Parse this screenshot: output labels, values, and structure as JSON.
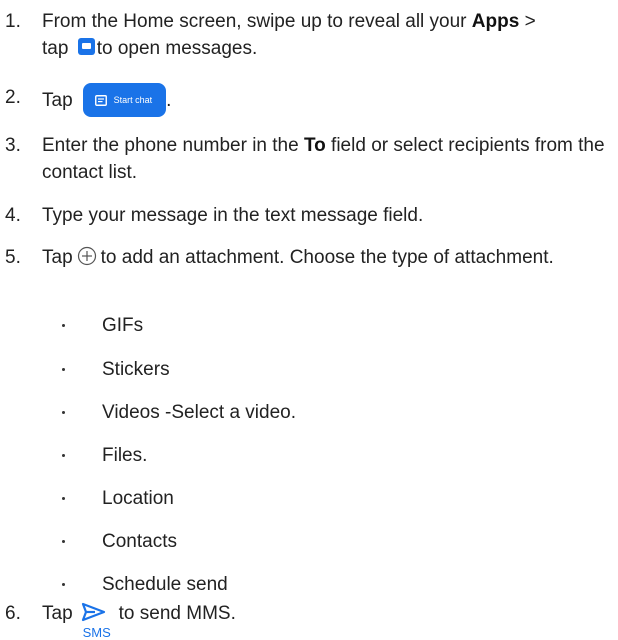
{
  "steps": [
    {
      "num": "1.",
      "pre": "From the Home screen, swipe up to reveal all your ",
      "bold": "Apps",
      "mid": " >",
      "line2_pre": "tap ",
      "icon": "messages-icon",
      "post": "to open messages."
    },
    {
      "num": "2.",
      "pre": "Tap",
      "button_label": "Start chat",
      "post": "."
    },
    {
      "num": "3.",
      "pre": "Enter the phone number in the ",
      "bold": "To",
      "post": " field or select recipients from the contact list."
    },
    {
      "num": "4.",
      "text": "Type your message in the text message field."
    },
    {
      "num": "5.",
      "pre": "Tap",
      "icon": "plus-circle-icon",
      "post": "to add an attachment. Choose the type of attachment."
    },
    {
      "num": "6.",
      "pre": "Tap",
      "icon": "send-icon",
      "icon_label": "SMS",
      "post": "to send MMS."
    }
  ],
  "attachments": [
    "GIFs",
    "Stickers",
    "Videos -Select a video.",
    "Files.",
    "Location",
    "Contacts",
    "Schedule send"
  ],
  "colors": {
    "accent": "#1a73e8",
    "text": "#222222"
  }
}
